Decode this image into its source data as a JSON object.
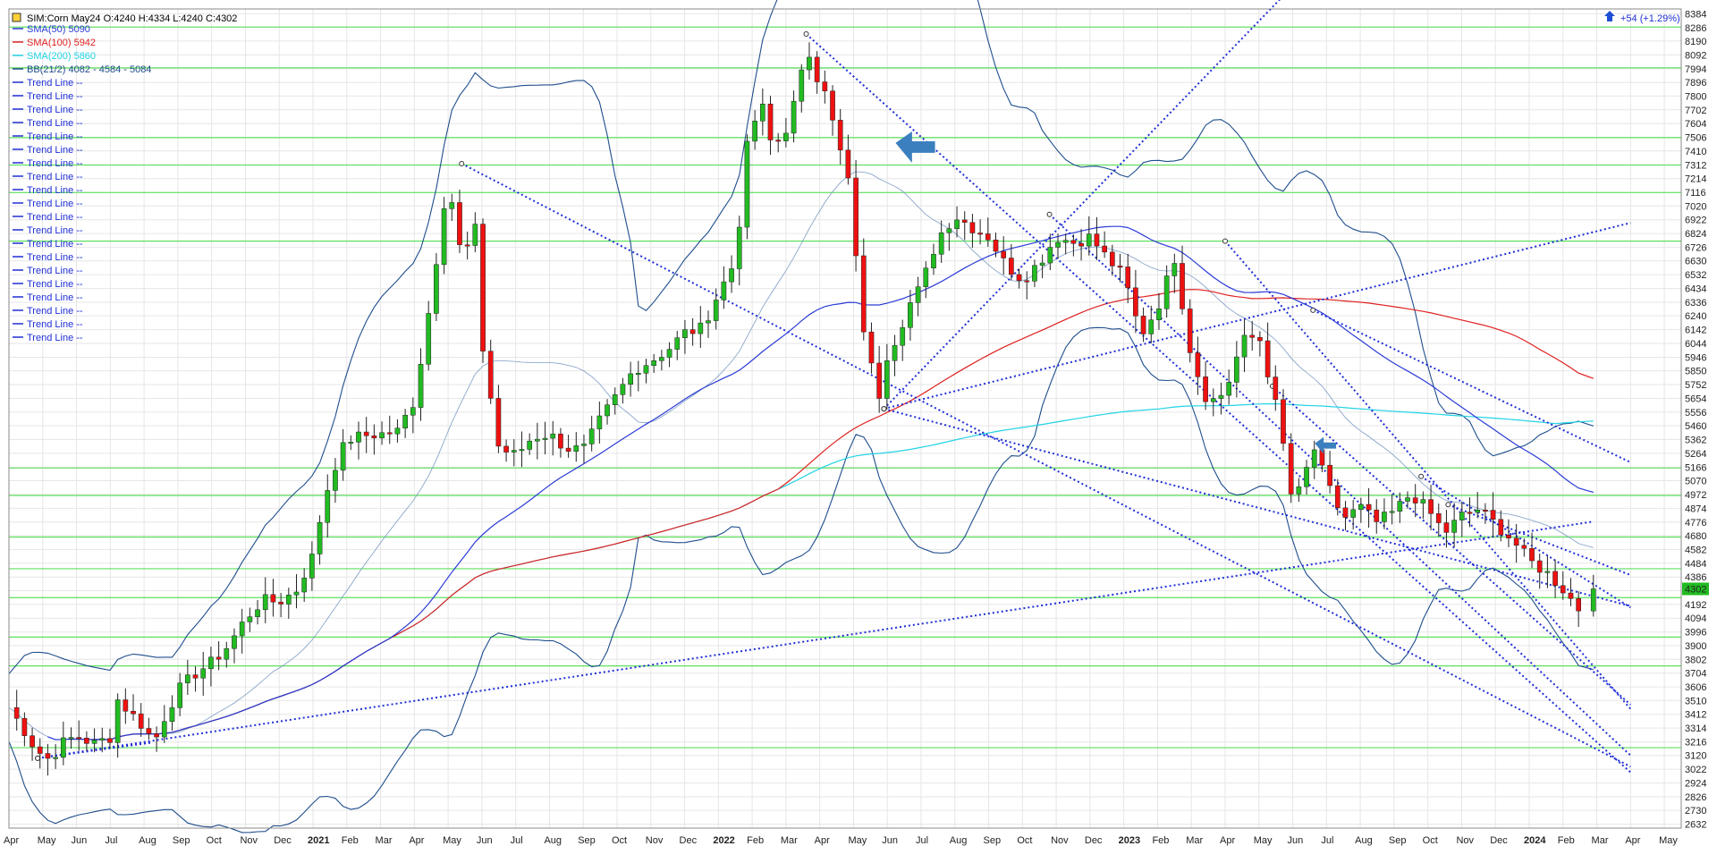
{
  "header": {
    "symbol_line": "SIM:Corn May24 O:4240 H:4334 L:4240 C:4302",
    "change": "+54 (+1.29%)"
  },
  "legend": [
    {
      "text": "SMA(50)  5090",
      "color": "#2b3bd6"
    },
    {
      "text": "SMA(100)  5942",
      "color": "#e02020"
    },
    {
      "text": "SMA(200)  5860",
      "color": "#22d3e6"
    },
    {
      "text": "BB(21/2) 4082 - 4584 - 5084",
      "color": "#1f4e8c"
    },
    {
      "text": "Trend Line  --",
      "color": "#1f2fd6"
    },
    {
      "text": "Trend Line  --",
      "color": "#1f2fd6"
    },
    {
      "text": "Trend Line  --",
      "color": "#1f2fd6"
    },
    {
      "text": "Trend Line  --",
      "color": "#1f2fd6"
    },
    {
      "text": "Trend Line  --",
      "color": "#1f2fd6"
    },
    {
      "text": "Trend Line  --",
      "color": "#1f2fd6"
    },
    {
      "text": "Trend Line  --",
      "color": "#1f2fd6"
    },
    {
      "text": "Trend Line  --",
      "color": "#1f2fd6"
    },
    {
      "text": "Trend Line  --",
      "color": "#1f2fd6"
    },
    {
      "text": "Trend Line  --",
      "color": "#1f2fd6"
    },
    {
      "text": "Trend Line  --",
      "color": "#1f2fd6"
    },
    {
      "text": "Trend Line  --",
      "color": "#1f2fd6"
    },
    {
      "text": "Trend Line  --",
      "color": "#1f2fd6"
    },
    {
      "text": "Trend Line  --",
      "color": "#1f2fd6"
    },
    {
      "text": "Trend Line  --",
      "color": "#1f2fd6"
    },
    {
      "text": "Trend Line  --",
      "color": "#1f2fd6"
    },
    {
      "text": "Trend Line  --",
      "color": "#1f2fd6"
    },
    {
      "text": "Trend Line  --",
      "color": "#1f2fd6"
    },
    {
      "text": "Trend Line  --",
      "color": "#1f2fd6"
    },
    {
      "text": "Trend Line  --",
      "color": "#1f2fd6"
    }
  ],
  "colors": {
    "up_candle": "#22bb22",
    "down_candle": "#ee1111",
    "sma50": "#2b3bd6",
    "sma100": "#e02020",
    "sma200": "#22d3e6",
    "bollinger": "#1f4e8c",
    "trend": "#1f2fd6",
    "hline": "#5ee05e",
    "grid": "#e6e6e6",
    "price_tag": "#22bb22",
    "arrow": "#3b7fbf"
  },
  "chart_data": {
    "type": "candlestick",
    "symbol": "SIM:Corn May24",
    "last": {
      "open": 4240,
      "high": 4334,
      "low": 4240,
      "close": 4302
    },
    "current_price_label": "4302",
    "y_ticks": [
      8384,
      8286,
      8190,
      8092,
      7994,
      7896,
      7800,
      7702,
      7604,
      7506,
      7410,
      7312,
      7214,
      7116,
      7020,
      6922,
      6824,
      6726,
      6630,
      6532,
      6434,
      6336,
      6240,
      6142,
      6044,
      5946,
      5850,
      5752,
      5654,
      5556,
      5460,
      5362,
      5264,
      5166,
      5070,
      4972,
      4874,
      4776,
      4680,
      4582,
      4484,
      4386,
      4290,
      4192,
      4094,
      3996,
      3900,
      3802,
      3704,
      3606,
      3510,
      3412,
      3314,
      3216,
      3120,
      3022,
      2924,
      2826,
      2730,
      2632
    ],
    "y_range": [
      2604,
      8418
    ],
    "x_labels": [
      "Apr",
      "May",
      "Jun",
      "Jul",
      "Aug",
      "Sep",
      "Oct",
      "Nov",
      "Dec",
      "2021",
      "Feb",
      "Mar",
      "Apr",
      "May",
      "Jun",
      "Jul",
      "Aug",
      "Sep",
      "Oct",
      "Nov",
      "Dec",
      "2022",
      "Feb",
      "Mar",
      "Apr",
      "May",
      "Jun",
      "Jul",
      "Aug",
      "Sep",
      "Oct",
      "Nov",
      "Dec",
      "2023",
      "Feb",
      "Mar",
      "Apr",
      "May",
      "Jun",
      "Jul",
      "Aug",
      "Sep",
      "Oct",
      "Nov",
      "Dec",
      "2024",
      "Feb",
      "Mar",
      "Apr",
      "May"
    ],
    "x_range_months": [
      0,
      49.5
    ],
    "horizontal_levels": [
      8290,
      8000,
      7505,
      7310,
      7115,
      6770,
      5160,
      4965,
      4670,
      4445,
      4240,
      3960,
      3755,
      3175
    ],
    "anchor_closes": [
      [
        0,
        3460
      ],
      [
        0.5,
        3280
      ],
      [
        0.8,
        3160
      ],
      [
        1.2,
        3090
      ],
      [
        1.6,
        3210
      ],
      [
        2,
        3260
      ],
      [
        2.5,
        3200
      ],
      [
        3,
        3250
      ],
      [
        3.2,
        3520
      ],
      [
        3.6,
        3420
      ],
      [
        4,
        3320
      ],
      [
        4.3,
        3210
      ],
      [
        4.6,
        3390
      ],
      [
        5,
        3580
      ],
      [
        5.5,
        3700
      ],
      [
        6,
        3780
      ],
      [
        6.5,
        3900
      ],
      [
        7,
        4090
      ],
      [
        7.5,
        4220
      ],
      [
        8,
        4210
      ],
      [
        8.5,
        4290
      ],
      [
        9,
        4540
      ],
      [
        9.3,
        4910
      ],
      [
        9.6,
        5150
      ],
      [
        10,
        5360
      ],
      [
        10.5,
        5390
      ],
      [
        11,
        5400
      ],
      [
        11.5,
        5420
      ],
      [
        12,
        5640
      ],
      [
        12.5,
        6380
      ],
      [
        13,
        7250
      ],
      [
        13.25,
        6800
      ],
      [
        13.5,
        6600
      ],
      [
        13.75,
        7050
      ],
      [
        14,
        6050
      ],
      [
        14.5,
        5300
      ],
      [
        15,
        5250
      ],
      [
        15.5,
        5380
      ],
      [
        16,
        5400
      ],
      [
        16.5,
        5300
      ],
      [
        17,
        5290
      ],
      [
        17.5,
        5500
      ],
      [
        18,
        5680
      ],
      [
        18.5,
        5860
      ],
      [
        19,
        5920
      ],
      [
        19.5,
        6000
      ],
      [
        20,
        6120
      ],
      [
        20.5,
        6150
      ],
      [
        21,
        6400
      ],
      [
        21.5,
        6630
      ],
      [
        21.9,
        7550
      ],
      [
        22.3,
        7720
      ],
      [
        22.6,
        7420
      ],
      [
        23,
        7570
      ],
      [
        23.4,
        7860
      ],
      [
        23.6,
        8160
      ],
      [
        23.9,
        7950
      ],
      [
        24.2,
        7850
      ],
      [
        24.5,
        7450
      ],
      [
        24.8,
        7310
      ],
      [
        25,
        6780
      ],
      [
        25.3,
        6150
      ],
      [
        25.5,
        5900
      ],
      [
        25.8,
        5650
      ],
      [
        26,
        5980
      ],
      [
        26.3,
        6100
      ],
      [
        26.6,
        6300
      ],
      [
        27,
        6450
      ],
      [
        27.5,
        6800
      ],
      [
        28,
        6950
      ],
      [
        28.5,
        6870
      ],
      [
        29,
        6800
      ],
      [
        29.5,
        6600
      ],
      [
        30,
        6500
      ],
      [
        30.5,
        6620
      ],
      [
        31,
        6800
      ],
      [
        31.5,
        6760
      ],
      [
        32,
        6800
      ],
      [
        32.5,
        6650
      ],
      [
        33,
        6520
      ],
      [
        33.5,
        6100
      ],
      [
        34,
        6300
      ],
      [
        34.5,
        6650
      ],
      [
        35,
        5950
      ],
      [
        35.5,
        5620
      ],
      [
        36,
        5700
      ],
      [
        36.5,
        6060
      ],
      [
        37,
        6100
      ],
      [
        37.3,
        5800
      ],
      [
        37.6,
        5500
      ],
      [
        38,
        4900
      ],
      [
        38.3,
        5050
      ],
      [
        38.6,
        5320
      ],
      [
        39,
        5050
      ],
      [
        39.5,
        4800
      ],
      [
        40,
        4880
      ],
      [
        40.5,
        4770
      ],
      [
        41,
        4850
      ],
      [
        41.5,
        4980
      ],
      [
        42,
        4860
      ],
      [
        42.5,
        4700
      ],
      [
        43,
        4820
      ],
      [
        43.5,
        4870
      ],
      [
        44,
        4760
      ],
      [
        44.5,
        4650
      ],
      [
        45,
        4500
      ],
      [
        45.5,
        4420
      ],
      [
        46,
        4300
      ],
      [
        46.5,
        4150
      ],
      [
        46.9,
        4302
      ]
    ],
    "annotations": [
      {
        "type": "arrow",
        "x_month": 26.05,
        "price": 7420,
        "direction": "down-left"
      },
      {
        "type": "arrow",
        "x_month": 38.55,
        "price": 5310,
        "direction": "down-left"
      }
    ]
  }
}
